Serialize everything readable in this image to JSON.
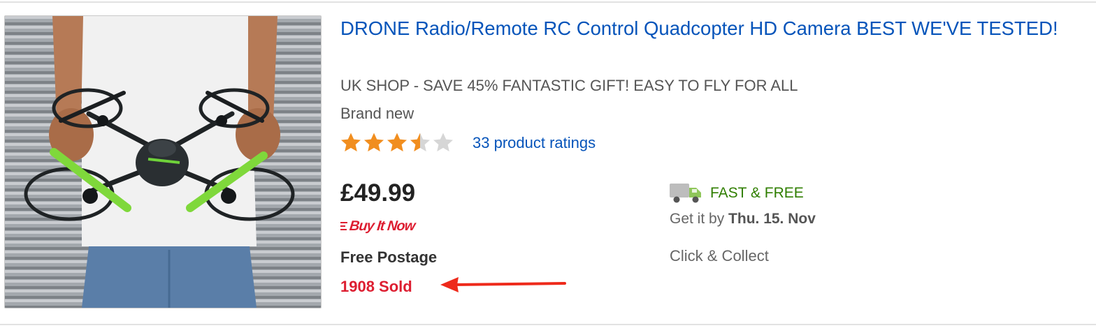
{
  "listing": {
    "title": "DRONE Radio/Remote RC Control Quadcopter HD Camera BEST WE'VE TESTED!",
    "subtitle": "UK SHOP - SAVE 45% FANTASTIC GIFT! EASY TO FLY FOR ALL",
    "condition": "Brand new",
    "rating": 3.5,
    "rating_max": 5,
    "ratings_link": "33 product ratings",
    "price": "£49.99",
    "buy_it_now": "Buy It Now",
    "postage": "Free Postage",
    "sold": "1908 Sold",
    "shipping_badge": "FAST & FREE",
    "delivery_prefix": "Get it by",
    "delivery_date": "Thu. 15. Nov",
    "collect": "Click & Collect",
    "image_icon": "drone-product-photo"
  },
  "colors": {
    "link": "#0654ba",
    "star_filled": "#f18e1f",
    "star_empty": "#d6d6d6",
    "sold": "#dd1e31",
    "shipping": "#2f7e00",
    "arrow": "#ee2a1b"
  }
}
